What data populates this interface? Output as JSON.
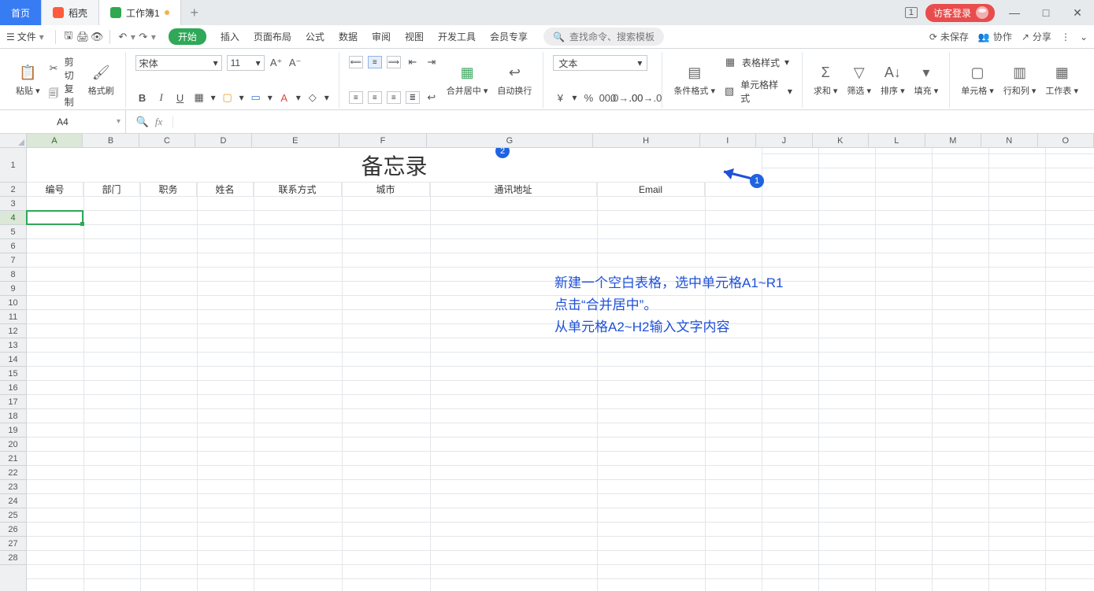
{
  "app_tabs": {
    "home": "首页",
    "doc1": "稻壳",
    "doc2": "工作簿1",
    "plus": "+",
    "badge_num": "1",
    "login": "访客登录",
    "win_min": "—",
    "win_max": "□",
    "win_close": "✕"
  },
  "menu": {
    "file_label": "文件",
    "hamburger": "☰",
    "caret": "▾",
    "qa": {
      "save": "🖫",
      "print": "🖨",
      "preview": "👁",
      "undo": "↶",
      "redo": "↷"
    },
    "tabs": {
      "start": "开始",
      "insert": "插入",
      "layout": "页面布局",
      "formula": "公式",
      "data": "数据",
      "review": "审阅",
      "view": "视图",
      "dev": "开发工具",
      "vip": "会员专享"
    },
    "search_placeholder": "查找命令、搜索模板",
    "right": {
      "unsaved": "未保存",
      "coop": "协作",
      "share": "分享",
      "unsaved_ico": "⟳",
      "coop_ico": "👥",
      "share_ico": "↗",
      "more_ico": "⋮",
      "chev": "⌄"
    }
  },
  "ribbon": {
    "paste": {
      "label": "粘贴",
      "ico": "📋"
    },
    "clip": {
      "cut_ico": "✂",
      "cut": "剪切",
      "copy_ico": "🗐",
      "copy": "复制",
      "brush_ico": "🖌",
      "brush": "格式刷"
    },
    "font": {
      "name": "宋体",
      "size": "11",
      "grow": "A⁺",
      "shrink": "A⁻",
      "bold": "B",
      "italic": "I",
      "under": "U",
      "border": "▦",
      "fill": "▢",
      "outline": "▭",
      "fontcolor": "A",
      "clear": "◇"
    },
    "align": {
      "t": "⟸",
      "m": "≡",
      "b": "⟹",
      "lrot": "↺",
      "rrot": "↻",
      "l": "≡",
      "c": "≡",
      "r": "≡",
      "j": "≣",
      "wrap": "↩",
      "il": "⇤",
      "ir": "⇥",
      "merge_label": "合并居中",
      "merge_ico": "▦",
      "autowrap_label": "自动换行",
      "autowrap_ico": "↩"
    },
    "numfmt": {
      "name": "文本",
      "cur": "¥",
      "pct": "%",
      "comma": "000",
      "dec_inc": ".0→.00",
      "dec_dec": ".00→.0"
    },
    "styles": {
      "cond": "条件格式",
      "cond_ico": "▤",
      "tblstyle": "表格样式",
      "tblstyle_ico": "▦",
      "cellstyle": "单元格样式",
      "cellstyle_ico": "▧"
    },
    "calc": {
      "sum": "求和",
      "sum_ico": "Σ",
      "filter": "筛选",
      "filter_ico": "▽",
      "sort": "排序",
      "sort_ico": "A↓",
      "fill": "填充",
      "fill_ico": "▾"
    },
    "cells": {
      "cell": "单元格",
      "cell_ico": "▢",
      "rowcol": "行和列",
      "rowcol_ico": "▥",
      "sheet": "工作表",
      "sheet_ico": "▦"
    }
  },
  "fx": {
    "name": "A4",
    "search_ico": "🔍",
    "fx": "fx",
    "formula": ""
  },
  "columns": [
    "A",
    "B",
    "C",
    "D",
    "E",
    "F",
    "G",
    "H",
    "I",
    "J",
    "K",
    "L",
    "M",
    "N",
    "O"
  ],
  "active_col": "A",
  "row_headers": {
    "count": 28,
    "tall_row": 1,
    "active_row": 4
  },
  "title_cell": "备忘录",
  "row2": {
    "A": "编号",
    "B": "部门",
    "C": "职务",
    "D": "姓名",
    "E": "联系方式",
    "F": "城市",
    "G": "通讯地址",
    "H": "Email"
  },
  "annotation": {
    "l1": "新建一个空白表格，选中单元格A1~R1",
    "l2": "点击“合并居中”。",
    "l3": "从单元格A2~H2输入文字内容",
    "m1": "1",
    "m2": "2"
  }
}
